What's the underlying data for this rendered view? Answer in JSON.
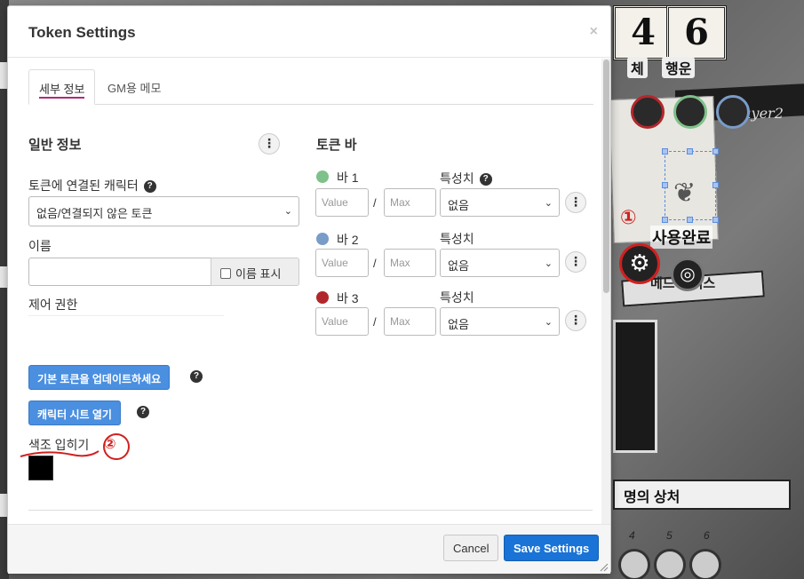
{
  "dialog": {
    "title": "Token Settings",
    "close_glyph": "×",
    "tabs": [
      {
        "label": "세부 정보",
        "active": true
      },
      {
        "label": "GM용 메모",
        "active": false
      }
    ],
    "general": {
      "heading": "일반 정보",
      "linked_character_label": "토큰에 연결된 캐릭터",
      "linked_character_value": "없음/연결되지 않은 토큰",
      "name_label": "이름",
      "name_value": "",
      "show_name_label": "이름 표시",
      "show_name_checked": false,
      "control_label": "제어 권한",
      "update_default_token_button": "기본 토큰을 업데이트하세요",
      "open_character_sheet_button": "캐릭터 시트 열기",
      "tint_label": "색조 입히기",
      "tint_color": "#000000"
    },
    "token_bars": {
      "heading": "토큰 바",
      "attribute_label": "특성치",
      "value_placeholder": "Value",
      "max_placeholder": "Max",
      "slash": "/",
      "bars": [
        {
          "label": "바 1",
          "color": "#7ec18a",
          "attribute": "없음",
          "show_attribute_label": true,
          "show_help": true
        },
        {
          "label": "바 2",
          "color": "#7a9cc8",
          "attribute": "없음",
          "show_attribute_label": true,
          "show_help": false
        },
        {
          "label": "바 3",
          "color": "#b2272c",
          "attribute": "없음",
          "show_attribute_label": true,
          "show_help": false
        }
      ]
    },
    "footer": {
      "cancel_label": "Cancel",
      "save_label": "Save Settings"
    }
  },
  "annotations": {
    "mark_1": "①",
    "mark_2": "②"
  },
  "background": {
    "stat_values": [
      "4",
      "6"
    ],
    "stat_labels": [
      "체",
      "행운"
    ],
    "banner_text": "ayer2",
    "used_label": "사용완료",
    "ribbon_text": "메드 이터스",
    "frame_text": "명의 상처",
    "dial_numbers": [
      "4",
      "5",
      "6"
    ],
    "gear_glyph": "⚙",
    "token_glyph": "◎"
  },
  "colors": {
    "accent_blue": "#1a73d6",
    "button_blue": "#4a8fe0",
    "tab_underline": "#b12a7a",
    "annotation_red": "#d12020"
  }
}
